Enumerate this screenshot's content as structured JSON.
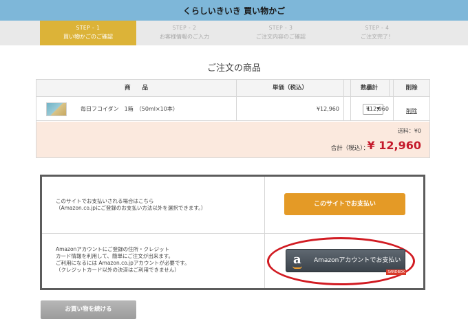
{
  "header": {
    "title": "くらしいきいき 買い物かご"
  },
  "steps": [
    {
      "num": "STEP - 1",
      "label": "買い物かごのご確認",
      "active": true
    },
    {
      "num": "STEP - 2",
      "label": "お客様情報のご入力",
      "active": false
    },
    {
      "num": "STEP - 3",
      "label": "ご注文内容のご確認",
      "active": false
    },
    {
      "num": "STEP - 4",
      "label": "ご注文完了！",
      "active": false
    }
  ],
  "order": {
    "title": "ご注文の商品",
    "columns": {
      "product": "商　　品",
      "unit_price": "単価（税込）",
      "quantity": "数量",
      "subtotal": "小計",
      "delete": "削除"
    },
    "items": [
      {
        "name": "毎日フコイダン　1箱　（50ml×10本）",
        "unit_price": "¥12,960",
        "quantity": "1",
        "subtotal": "¥12,960",
        "delete_label": "削除"
      }
    ],
    "shipping": "送料：¥0",
    "total_label": "合計（税込）：",
    "total_value": "¥ 12,960"
  },
  "payment": {
    "site": {
      "text_line1": "このサイトでお支払いされる場合はこちら",
      "text_line2": "（Amazon.co.jpにご登録のお支払い方法以外を選択できます。）",
      "button_label": "このサイトでお支払い"
    },
    "amazon": {
      "text_line1": "Amazonアカウントにご登録の住所・クレジット",
      "text_line2": "カード情報を利用して、簡単にご注文が出来ます。",
      "text_line3": "ご利用になるには Amazon.co.jpアカウントが必要です。",
      "text_line4": "（クレジットカード以外の決済はご利用できません）",
      "logo_letter": "a",
      "button_label": "Amazonアカウントでお支払い",
      "badge": "SANDBOX"
    }
  },
  "continue_button": "お買い物を続ける",
  "colors": {
    "header_bg": "#7eb7d9",
    "active_step": "#dcb338",
    "site_pay": "#e49a26",
    "total": "#c4192b",
    "highlight_ring": "#d11b22"
  }
}
